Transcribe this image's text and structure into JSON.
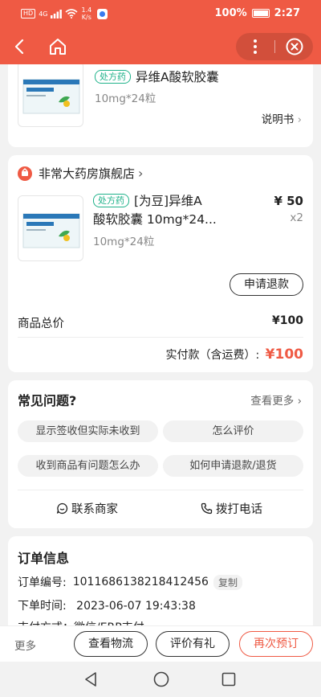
{
  "status_bar": {
    "signal": "HD",
    "network": "4G",
    "speed_value": "1.4",
    "speed_unit": "K/s",
    "battery": "100%",
    "time": "2:27"
  },
  "nav": {
    "back_icon": "chevron-left-icon",
    "home_icon": "home-icon",
    "more_icon": "more-vertical-icon",
    "close_icon": "close-circle-icon"
  },
  "product_top": {
    "badge": "处方药",
    "title": "异维A酸软胶囊",
    "spec": "10mg*24粒",
    "manual_link": "说明书"
  },
  "store": {
    "name": "非常大药房旗舰店",
    "product": {
      "badge": "处方药",
      "title_line1": "[为豆]异维A",
      "title_line2": "酸软胶囊 10mg*24...",
      "spec": "10mg*24粒",
      "price": "¥ 50",
      "qty": "x2"
    },
    "refund_button": "申请退款",
    "total_label": "商品总价",
    "total_value": "¥100",
    "paid_label": "实付款（含运费）:",
    "paid_value": "¥100"
  },
  "faq": {
    "title": "常见问题?",
    "more": "查看更多",
    "items": [
      "显示签收但实际未收到",
      "怎么评价",
      "收到商品有问题怎么办",
      "如何申请退款/退货"
    ],
    "contact_seller": "联系商家",
    "call_phone": "拨打电话"
  },
  "order_info": {
    "title": "订单信息",
    "number_label": "订单编号:",
    "number_value": "1011686138218412456",
    "copy_button": "复制",
    "time_label": "下单时间:",
    "time_value": "2023-06-07 19:43:38",
    "partial_row": "支付方式：微信/ERP支付"
  },
  "bottom_bar": {
    "more": "更多",
    "logistics": "查看物流",
    "review": "评价有礼",
    "reorder": "再次预订"
  },
  "colors": {
    "brand": "#ef5a44",
    "rx_green": "#1fb28a",
    "price_red": "#ef5a44"
  }
}
